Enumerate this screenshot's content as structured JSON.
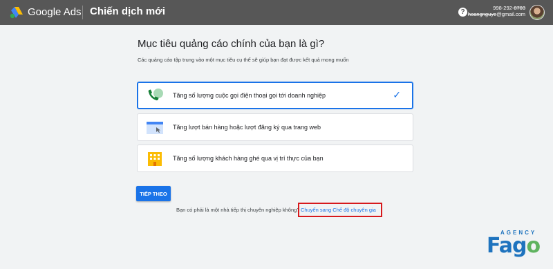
{
  "header": {
    "brand": "Google Ads",
    "page_title": "Chiến dịch mới",
    "help_glyph": "?",
    "account_phone": "998-292-",
    "account_phone_redacted": "8703",
    "account_email_redacted": "hoangnguye",
    "account_email_suffix": "@gmail.com"
  },
  "main": {
    "heading": "Mục tiêu quảng cáo chính của bạn là gì?",
    "subheading": "Các quảng cáo tập trung vào một mục tiêu cụ thể sẽ giúp bạn đạt được kết quả mong muốn",
    "options": [
      {
        "label": "Tăng số lượng cuộc gọi điện thoại gọi tới doanh nghiệp",
        "icon": "phone-call-icon",
        "selected": true
      },
      {
        "label": "Tăng lượt bán hàng hoặc lượt đăng ký qua trang web",
        "icon": "browser-window-icon",
        "selected": false
      },
      {
        "label": "Tăng số lượng khách hàng ghé qua vị trí thực của bạn",
        "icon": "storefront-icon",
        "selected": false
      }
    ],
    "check_glyph": "✓",
    "next_button": "TIẾP THEO",
    "expert_question": "Bạn có phải là một nhà tiếp thị chuyên nghiệp không?",
    "expert_link": "Chuyển sang Chế độ chuyên gia"
  },
  "watermark": {
    "top_word": "AGENCY",
    "name_a": "Fag",
    "name_b": "o"
  },
  "colors": {
    "topbar": "#575757",
    "accent": "#1a73e8",
    "highlight_box": "#d7191c",
    "background": "#f1f3f4"
  }
}
